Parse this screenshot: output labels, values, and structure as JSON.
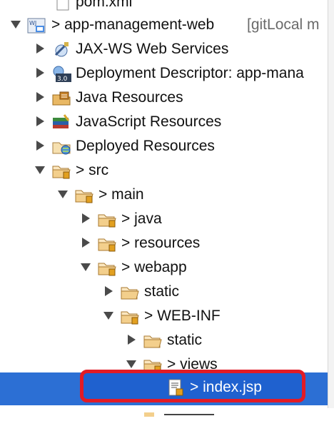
{
  "tree": {
    "items": [
      {
        "id": "pom",
        "label": "pom.xml"
      },
      {
        "id": "project",
        "label": "> app-management-web",
        "suffix": "[gitLocal m"
      },
      {
        "id": "jaxws",
        "label": "JAX-WS Web Services"
      },
      {
        "id": "deploy-desc",
        "label": "Deployment Descriptor: app-mana"
      },
      {
        "id": "java-res",
        "label": "Java Resources"
      },
      {
        "id": "js-res",
        "label": "JavaScript Resources"
      },
      {
        "id": "deployed-res",
        "label": "Deployed Resources"
      },
      {
        "id": "src",
        "label": "> src"
      },
      {
        "id": "main",
        "label": "> main"
      },
      {
        "id": "java",
        "label": "> java"
      },
      {
        "id": "resources",
        "label": "> resources"
      },
      {
        "id": "webapp",
        "label": "> webapp"
      },
      {
        "id": "static1",
        "label": "static"
      },
      {
        "id": "webinf",
        "label": "> WEB-INF"
      },
      {
        "id": "static2",
        "label": "static"
      },
      {
        "id": "views",
        "label": "> views"
      },
      {
        "id": "indexjsp",
        "label": "> index.jsp"
      }
    ]
  },
  "selection": {
    "item": "indexjsp"
  },
  "icons": {
    "folder": "folder-icon",
    "package": "package-folder-icon",
    "project": "web-project-icon",
    "jsp": "jsp-file-icon"
  }
}
